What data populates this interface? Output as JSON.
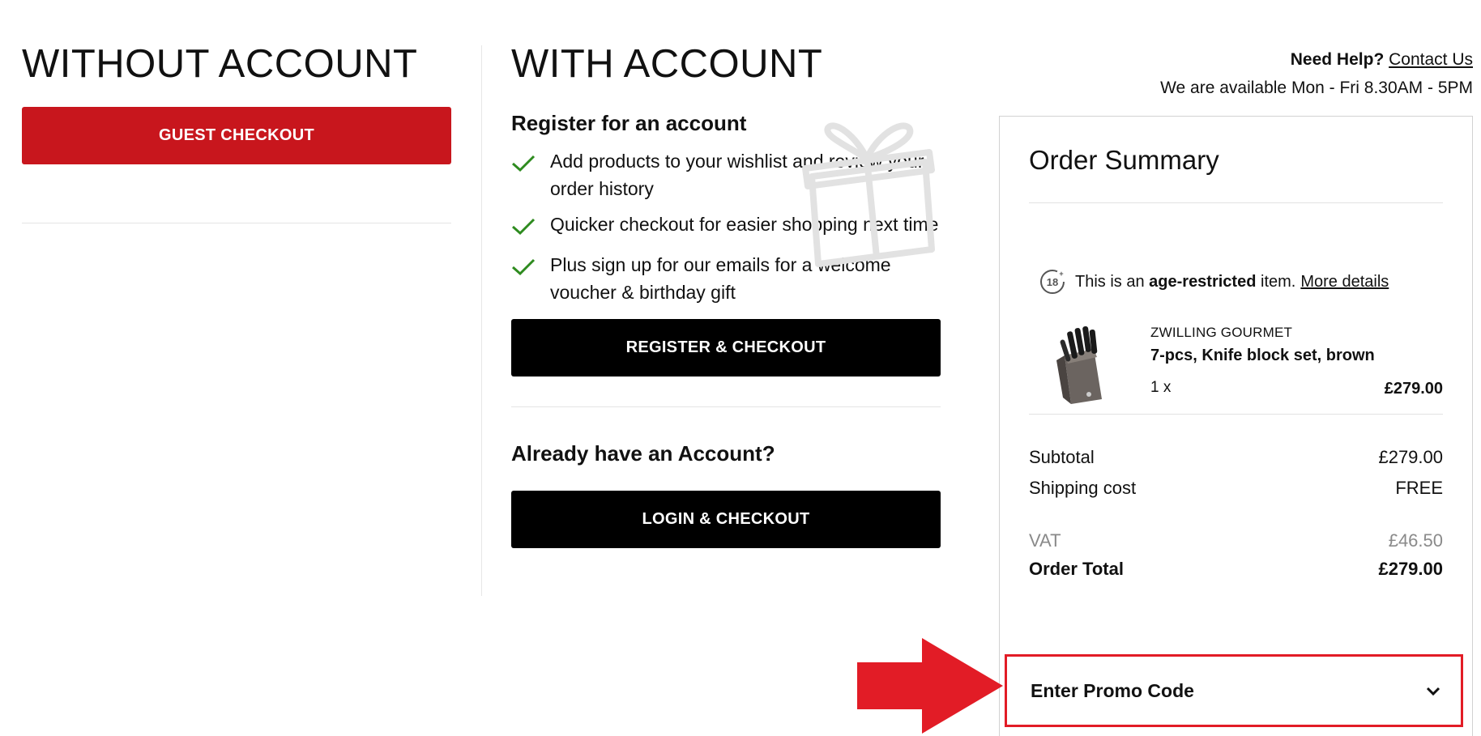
{
  "left": {
    "heading": "WITHOUT ACCOUNT",
    "guest_button": "GUEST CHECKOUT"
  },
  "mid": {
    "heading": "WITH ACCOUNT",
    "register_heading": "Register for an account",
    "benefits": [
      {
        "text": "Add products to your wishlist and review your order history"
      },
      {
        "text": "Quicker checkout for easier shopping next time"
      },
      {
        "text": "Plus sign up for our emails for a welcome voucher & birthday gift"
      }
    ],
    "register_button": "REGISTER & CHECKOUT",
    "existing_heading": "Already have an Account?",
    "login_button": "LOGIN & CHECKOUT"
  },
  "help": {
    "label": "Need Help?",
    "contact_link": "Contact Us",
    "availability": "We are available Mon - Fri 8.30AM - 5PM"
  },
  "summary": {
    "title": "Order Summary",
    "age_notice_prefix": "This is an",
    "age_notice_bold": "age-restricted",
    "age_notice_suffix": "item.",
    "age_link": "More details",
    "age_badge": "18+",
    "product": {
      "brand": "ZWILLING GOURMET",
      "name": "7-pcs, Knife block set, brown",
      "qty": "1 x",
      "price": "£279.00"
    },
    "subtotal_label": "Subtotal",
    "subtotal_value": "£279.00",
    "shipping_label": "Shipping cost",
    "shipping_value": "FREE",
    "vat_label": "VAT",
    "vat_value": "£46.50",
    "total_label": "Order Total",
    "total_value": "£279.00",
    "promo_label": "Enter Promo Code"
  },
  "colors": {
    "guest_button": "#c8161d",
    "dark_buttons": "#000000",
    "check": "#2e8b1f",
    "highlight": "#e21c26"
  }
}
